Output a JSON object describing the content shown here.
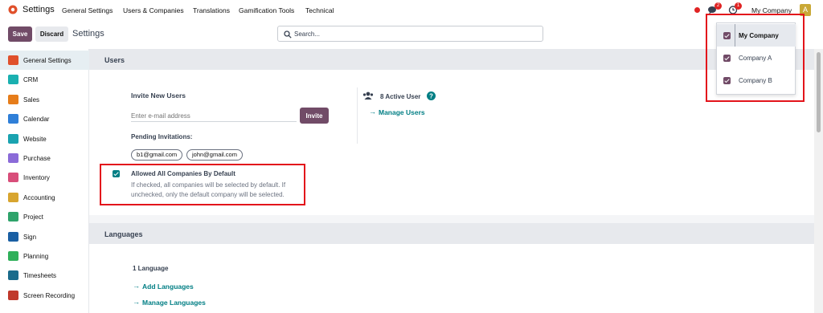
{
  "topnav": {
    "app_title": "Settings",
    "menu": [
      "General Settings",
      "Users & Companies",
      "Translations",
      "Gamification Tools",
      "Technical"
    ],
    "chat_badge": "2",
    "activity_badge": "1",
    "company": "My Company",
    "avatar_initial": "A"
  },
  "control": {
    "save_label": "Save",
    "discard_label": "Discard",
    "title": "Settings",
    "search_placeholder": "Search..."
  },
  "sidebar": {
    "items": [
      {
        "label": "General Settings",
        "icon": "settings-icon",
        "color": "#e0502b"
      },
      {
        "label": "CRM",
        "icon": "crm-icon",
        "color": "#1ab0b0"
      },
      {
        "label": "Sales",
        "icon": "sales-icon",
        "color": "#e67d1a"
      },
      {
        "label": "Calendar",
        "icon": "calendar-icon",
        "color": "#2f7fd8"
      },
      {
        "label": "Website",
        "icon": "website-icon",
        "color": "#1aa3b0"
      },
      {
        "label": "Purchase",
        "icon": "purchase-icon",
        "color": "#8b6bd8"
      },
      {
        "label": "Inventory",
        "icon": "inventory-icon",
        "color": "#d84e7a"
      },
      {
        "label": "Accounting",
        "icon": "accounting-icon",
        "color": "#d8a52f"
      },
      {
        "label": "Project",
        "icon": "project-icon",
        "color": "#2fa36b"
      },
      {
        "label": "Sign",
        "icon": "sign-icon",
        "color": "#1a5fa3"
      },
      {
        "label": "Planning",
        "icon": "planning-icon",
        "color": "#2fb05a"
      },
      {
        "label": "Timesheets",
        "icon": "timesheets-icon",
        "color": "#1a6b8b"
      },
      {
        "label": "Screen Recording",
        "icon": "screen-recording-icon",
        "color": "#c0392b"
      }
    ]
  },
  "users": {
    "section_title": "Users",
    "invite_title": "Invite New Users",
    "email_placeholder": "Enter e-mail address",
    "invite_button": "Invite",
    "pending_title": "Pending Invitations:",
    "pending": [
      "b1@gmail.com",
      "john@gmail.com"
    ],
    "active_users": "8 Active User",
    "manage_users": "Manage Users",
    "allow_all": {
      "checked": true,
      "title": "Allowed All Companies By Default",
      "desc_line1": "If checked, all companies will be selected by default. If",
      "desc_line2": "unchecked, only the default company will be selected."
    }
  },
  "languages": {
    "section_title": "Languages",
    "count": "1 Language",
    "add": "Add Languages",
    "manage": "Manage Languages"
  },
  "company_dropdown": [
    {
      "name": "My Company",
      "checked": true,
      "selected": true
    },
    {
      "name": "Company A",
      "checked": true,
      "selected": false
    },
    {
      "name": "Company B",
      "checked": true,
      "selected": false
    }
  ],
  "colors": {
    "brand": "#714b67",
    "link": "#017e84",
    "highlight": "#e3141b"
  }
}
